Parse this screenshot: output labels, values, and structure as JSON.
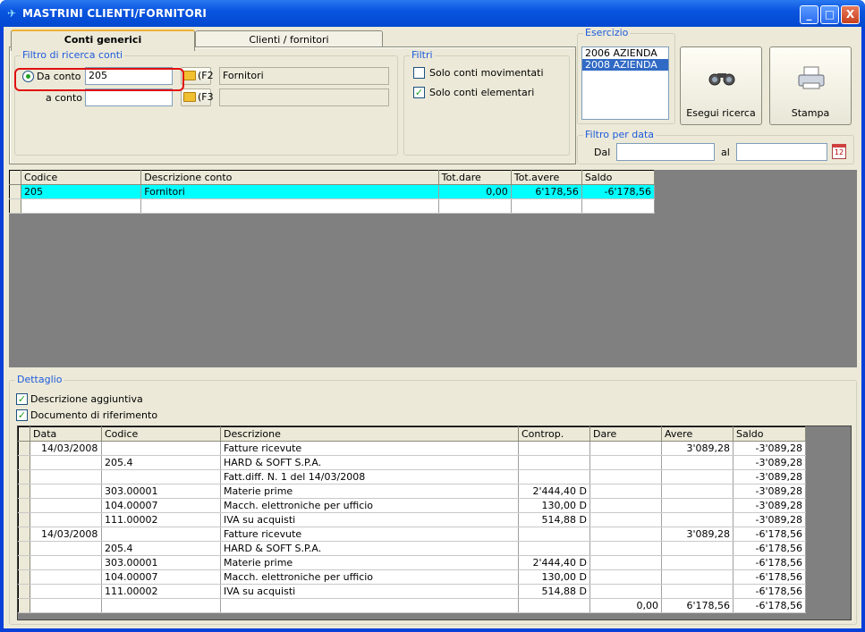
{
  "window": {
    "title": "MASTRINI CLIENTI/FORNITORI",
    "minimize": "_",
    "maximize": "□",
    "close": "X"
  },
  "tabs": [
    {
      "label": "Conti generici"
    },
    {
      "label": "Clienti / fornitori"
    }
  ],
  "filtro_ricerca": {
    "legend": "Filtro di ricerca conti",
    "da_conto_label": "Da conto",
    "da_conto_value": "205",
    "da_conto_key": "(F2",
    "da_conto_desc": "Fornitori",
    "a_conto_label": "a conto",
    "a_conto_value": "",
    "a_conto_key": "(F3",
    "a_conto_desc": ""
  },
  "filtri": {
    "legend": "Filtri",
    "solo_movimentati": {
      "label": "Solo conti movimentati",
      "checked": false
    },
    "solo_elementari": {
      "label": "Solo conti elementari",
      "checked": true
    }
  },
  "esercizio": {
    "legend": "Esercizio",
    "items": [
      "2006 AZIENDA",
      "2008 AZIENDA"
    ],
    "selected": "2008 AZIENDA"
  },
  "buttons": {
    "esegui": "Esegui ricerca",
    "stampa": "Stampa"
  },
  "filtro_data": {
    "legend": "Filtro per data",
    "dal_label": "Dal",
    "al_label": "al",
    "dal_value": "",
    "al_value": ""
  },
  "conti_grid": {
    "columns": [
      "Codice",
      "Descrizione conto",
      "Tot.dare",
      "Tot.avere",
      "Saldo"
    ],
    "rows": [
      [
        "205",
        "Fornitori",
        "0,00",
        "6'178,56",
        "-6'178,56"
      ]
    ]
  },
  "dettaglio": {
    "legend": "Dettaglio",
    "descrizione_aggiuntiva": {
      "label": "Descrizione aggiuntiva",
      "checked": true
    },
    "documento_riferimento": {
      "label": "Documento di riferimento",
      "checked": true
    },
    "columns": [
      "Data",
      "Codice",
      "Descrizione",
      "Controp.",
      "Dare",
      "Avere",
      "Saldo"
    ],
    "rows": [
      [
        "14/03/2008",
        "",
        "Fatture ricevute",
        "",
        "",
        "3'089,28",
        "-3'089,28"
      ],
      [
        "",
        "205.4",
        "HARD & SOFT S.P.A.",
        "",
        "",
        "",
        "-3'089,28"
      ],
      [
        "",
        "",
        "Fatt.diff. N. 1 del 14/03/2008",
        "",
        "",
        "",
        "-3'089,28"
      ],
      [
        "",
        "303.00001",
        "Materie prime",
        "2'444,40 D",
        "",
        "",
        "-3'089,28"
      ],
      [
        "",
        "104.00007",
        "Macch. elettroniche per ufficio",
        "130,00 D",
        "",
        "",
        "-3'089,28"
      ],
      [
        "",
        "111.00002",
        "IVA su acquisti",
        "514,88 D",
        "",
        "",
        "-3'089,28"
      ],
      [
        "14/03/2008",
        "",
        "Fatture ricevute",
        "",
        "",
        "3'089,28",
        "-6'178,56"
      ],
      [
        "",
        "205.4",
        "HARD & SOFT S.P.A.",
        "",
        "",
        "",
        "-6'178,56"
      ],
      [
        "",
        "303.00001",
        "Materie prime",
        "2'444,40 D",
        "",
        "",
        "-6'178,56"
      ],
      [
        "",
        "104.00007",
        "Macch. elettroniche per ufficio",
        "130,00 D",
        "",
        "",
        "-6'178,56"
      ],
      [
        "",
        "111.00002",
        "IVA su acquisti",
        "514,88 D",
        "",
        "",
        "-6'178,56"
      ],
      [
        "",
        "",
        "",
        "",
        "0,00",
        "6'178,56",
        "-6'178,56"
      ]
    ]
  }
}
